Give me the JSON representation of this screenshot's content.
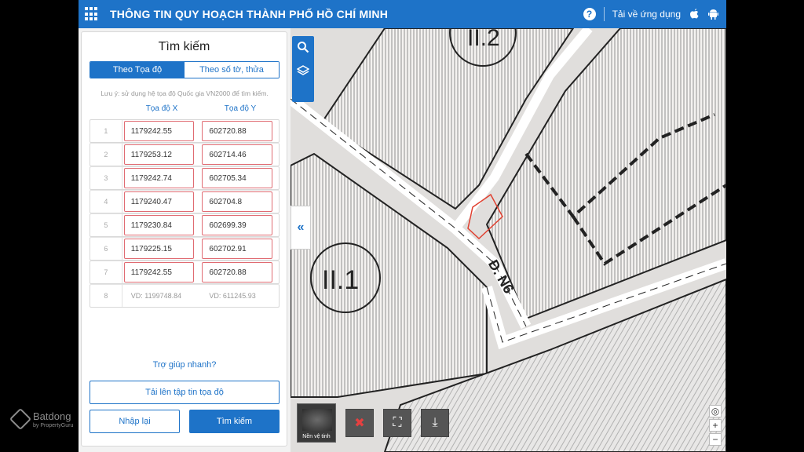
{
  "header": {
    "title": "THÔNG TIN QUY HOẠCH THÀNH PHỐ HỒ CHÍ MINH",
    "download_label": "Tải về ứng dụng",
    "help_symbol": "?",
    "apple_icon": "apple-icon",
    "android_icon": "android-icon"
  },
  "panel": {
    "title": "Tìm kiếm",
    "tabs": [
      {
        "label": "Theo Tọa độ",
        "active": true
      },
      {
        "label": "Theo số tờ, thửa",
        "active": false
      }
    ],
    "hint": "Lưu ý: sử dụng hệ tọa độ Quốc gia VN2000 để tìm kiếm.",
    "column_x": "Tọa độ X",
    "column_y": "Tọa độ Y",
    "rows": [
      {
        "index": "1",
        "x": "1179242.55",
        "y": "602720.88"
      },
      {
        "index": "2",
        "x": "1179253.12",
        "y": "602714.46"
      },
      {
        "index": "3",
        "x": "1179242.74",
        "y": "602705.34"
      },
      {
        "index": "4",
        "x": "1179240.47",
        "y": "602704.8"
      },
      {
        "index": "5",
        "x": "1179230.84",
        "y": "602699.39"
      },
      {
        "index": "6",
        "x": "1179225.15",
        "y": "602702.91"
      },
      {
        "index": "7",
        "x": "1179242.55",
        "y": "602720.88"
      }
    ],
    "empty_row": {
      "index": "8",
      "x_placeholder": "VD: 1199748.84",
      "y_placeholder": "VD: 611245.93"
    },
    "quick_help": "Trợ giúp nhanh?",
    "upload_label": "Tải lên tập tin tọa độ",
    "reset_label": "Nhập lại",
    "search_label": "Tìm kiếm"
  },
  "map": {
    "labels": [
      "II.2",
      "II.1",
      "Đ. N6"
    ],
    "base_layer_label": "Nền vệ tinh",
    "collapse_symbol": "«"
  },
  "watermark": {
    "brand": "Batdong",
    "sub": "by PropertyGuru"
  },
  "colors": {
    "primary": "#1e73c8",
    "field_border": "#e06b72",
    "parcel": "#e04030"
  }
}
